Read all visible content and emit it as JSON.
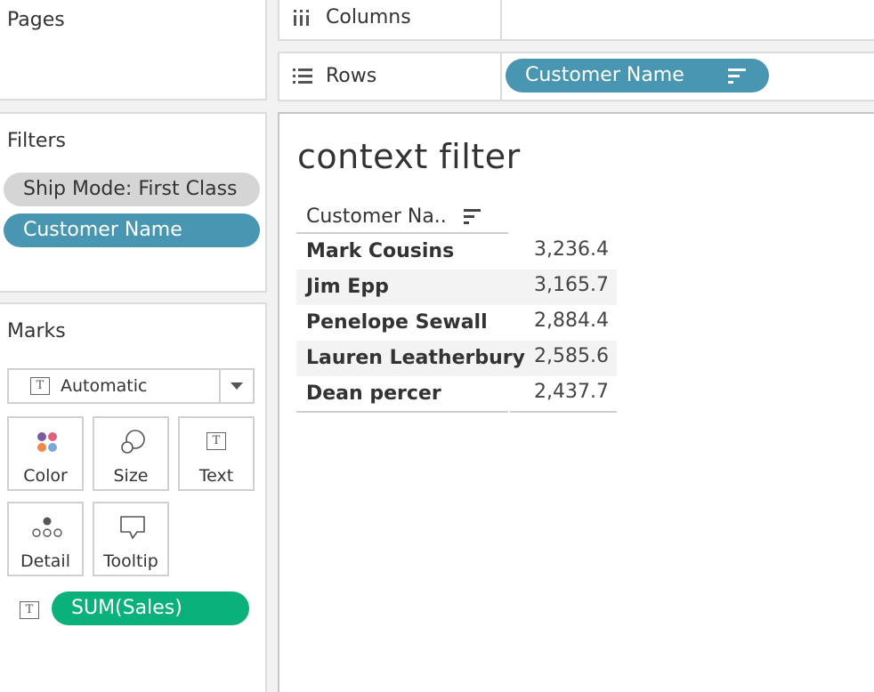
{
  "pages_card": {
    "label": "Pages"
  },
  "filters_card": {
    "label": "Filters",
    "pills": [
      "Ship Mode: First Class",
      "Customer Name"
    ]
  },
  "marks_card": {
    "label": "Marks",
    "mark_type": "Automatic",
    "buttons": {
      "color": "Color",
      "size": "Size",
      "text": "Text",
      "detail": "Detail",
      "tooltip": "Tooltip"
    },
    "text_pill": "SUM(Sales)",
    "text_pill_color": "#0bb17a"
  },
  "columns_shelf": {
    "label": "Columns"
  },
  "rows_shelf": {
    "label": "Rows",
    "pill": "Customer Name",
    "pill_color": "#4996b2"
  },
  "view": {
    "title": "context filter",
    "table": {
      "header": "Customer Na..",
      "rows": [
        {
          "name": "Mark Cousins",
          "value": "3,236.4"
        },
        {
          "name": "Jim Epp",
          "value": "3,165.7"
        },
        {
          "name": "Penelope Sewall",
          "value": "2,884.4"
        },
        {
          "name": "Lauren Leatherbury",
          "value": "2,585.6"
        },
        {
          "name": "Dean percer",
          "value": "2,437.7"
        }
      ]
    }
  }
}
